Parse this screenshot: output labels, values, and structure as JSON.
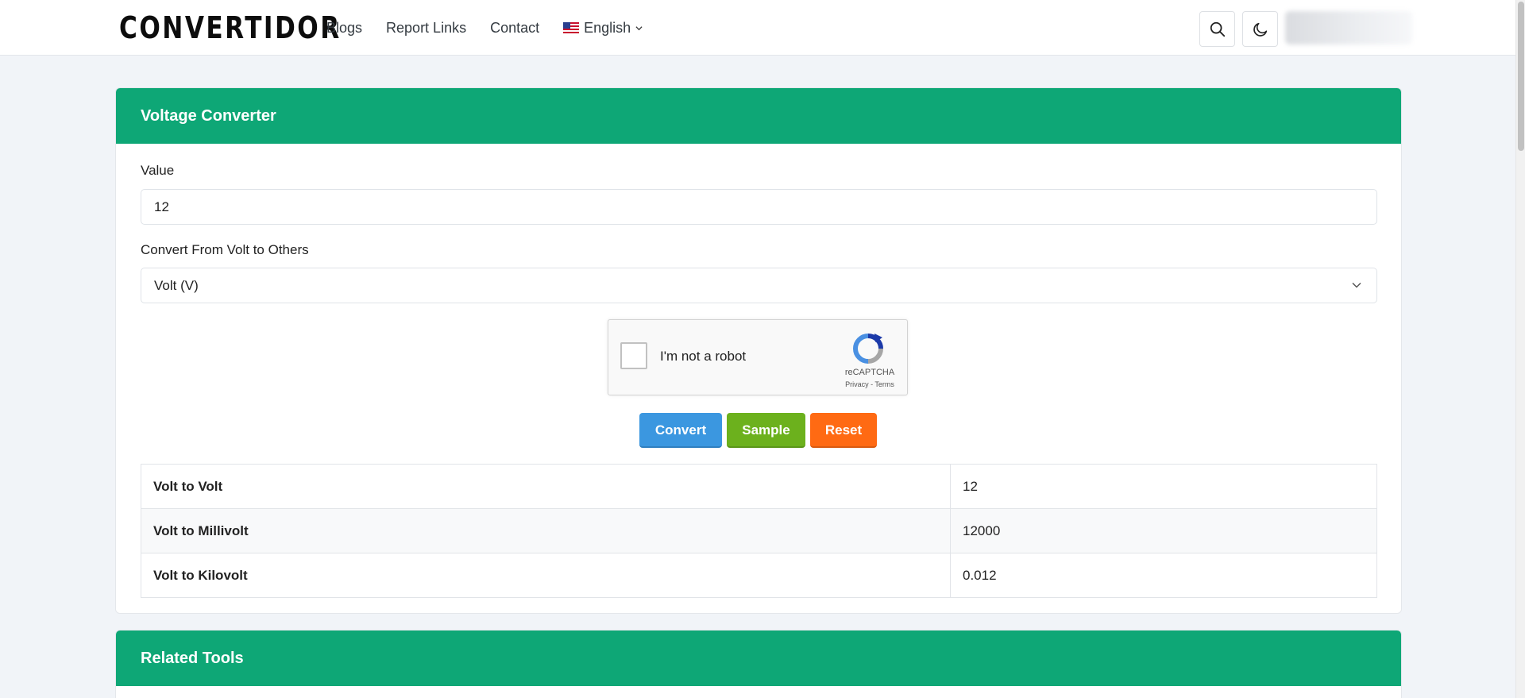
{
  "header": {
    "logo": "CONVERTIDOR",
    "nav": [
      "Blogs",
      "Report Links",
      "Contact"
    ],
    "language": "English"
  },
  "converter": {
    "title": "Voltage Converter",
    "value_label": "Value",
    "value": "12",
    "from_label": "Convert From Volt to Others",
    "from_selected": "Volt (V)",
    "captcha": {
      "label": "I'm not a robot",
      "brand": "reCAPTCHA",
      "links": "Privacy - Terms"
    },
    "buttons": {
      "convert": "Convert",
      "sample": "Sample",
      "reset": "Reset"
    },
    "results": [
      {
        "label": "Volt to Volt",
        "value": "12"
      },
      {
        "label": "Volt to Millivolt",
        "value": "12000"
      },
      {
        "label": "Volt to Kilovolt",
        "value": "0.012"
      }
    ]
  },
  "related": {
    "title": "Related Tools"
  },
  "colors": {
    "brand_green": "#0ea776",
    "convert_blue": "#3b97e0",
    "sample_green": "#6cb11d",
    "reset_orange": "#ff6a13"
  }
}
